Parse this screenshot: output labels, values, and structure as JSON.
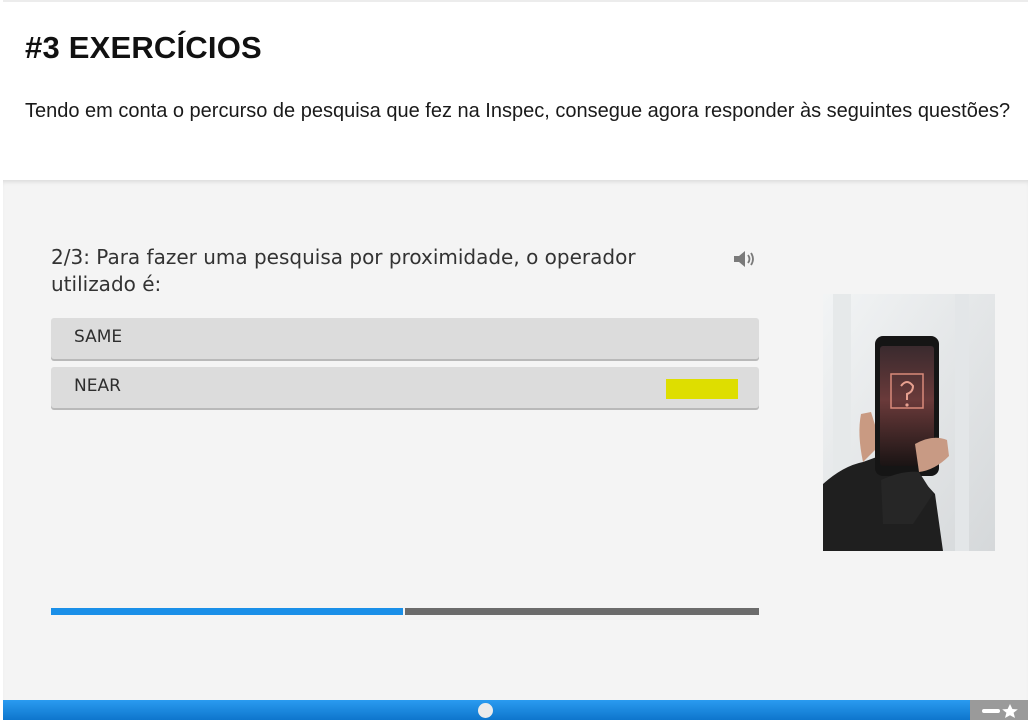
{
  "header": {
    "title": "#3 EXERCÍCIOS",
    "intro": "Tendo em conta o percurso de pesquisa que fez na Inspec, consegue agora responder às seguintes questões?"
  },
  "quiz": {
    "question": "2/3: Para fazer uma pesquisa por proximidade, o operador utilizado é:",
    "options": [
      {
        "label": "SAME"
      },
      {
        "label": "NEAR"
      }
    ],
    "highlight_color": "#dede00",
    "image_icon": "phone-question-mark-image",
    "audio_icon": "speaker-icon",
    "progress": {
      "current": 1,
      "total": 2,
      "fraction": 0.5,
      "fill_color": "#1a8fe8",
      "track_color": "#6b6b6b"
    }
  },
  "player": {
    "bar_color": "#1a8fe8",
    "scrubber_position": 0.47,
    "corner_icon": "key-star-icon"
  }
}
